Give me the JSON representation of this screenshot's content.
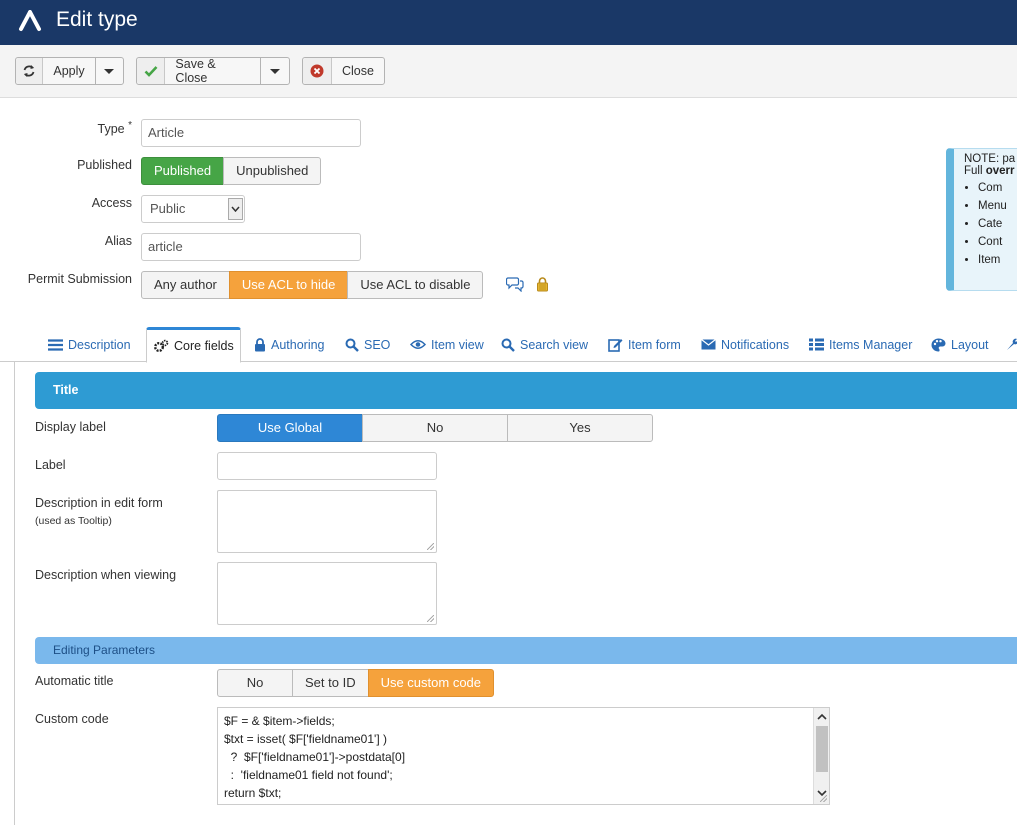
{
  "header": {
    "title": "Edit type"
  },
  "toolbar": {
    "apply": "Apply",
    "save_close": "Save & Close",
    "close": "Close"
  },
  "form": {
    "type_label": "Type",
    "required_mark": "*",
    "type_value": "Article",
    "published_label": "Published",
    "published_options": [
      "Published",
      "Unpublished"
    ],
    "published_selected": "Published",
    "access_label": "Access",
    "access_value": "Public",
    "alias_label": "Alias",
    "alias_value": "article",
    "permit_label": "Permit Submission",
    "permit_options": [
      "Any author",
      "Use ACL to hide",
      "Use ACL to disable"
    ],
    "permit_selected": "Use ACL to hide"
  },
  "note": {
    "line1": "NOTE: pa",
    "line2_prefix": "Full ",
    "line2_bold": "overr",
    "items": [
      "Com",
      "Menu",
      "Cate",
      "Cont",
      "Item"
    ]
  },
  "tabs": [
    {
      "label": "Description",
      "icon": "list-icon"
    },
    {
      "label": "Core fields",
      "icon": "cogs-icon",
      "active": true
    },
    {
      "label": "Authoring",
      "icon": "lock-icon"
    },
    {
      "label": "SEO",
      "icon": "search-icon"
    },
    {
      "label": "Item view",
      "icon": "eye-icon"
    },
    {
      "label": "Search view",
      "icon": "search-icon"
    },
    {
      "label": "Item form",
      "icon": "edit-icon"
    },
    {
      "label": "Notifications",
      "icon": "mail-icon"
    },
    {
      "label": "Items Manager",
      "icon": "grid-list-icon"
    },
    {
      "label": "Layout",
      "icon": "palette-icon"
    }
  ],
  "panel": {
    "section_title": "Title",
    "display_label": "Display label",
    "display_options": [
      "Use Global",
      "No",
      "Yes"
    ],
    "display_selected": "Use Global",
    "label_label": "Label",
    "label_value": "",
    "desc_edit_label": "Description in edit form",
    "desc_edit_hint": "(used as Tooltip)",
    "desc_view_label": "Description when viewing",
    "subsection_title": "Editing Parameters",
    "auto_title_label": "Automatic title",
    "auto_title_options": [
      "No",
      "Set to ID",
      "Use custom code"
    ],
    "auto_title_selected": "Use custom code",
    "custom_code_label": "Custom code",
    "custom_code": "$F = & $item->fields;\n$txt = isset( $F['fieldname01'] )\n  ?  $F['fieldname01']->postdata[0]\n  :  'fieldname01 field not found';\nreturn $txt;"
  },
  "colors": {
    "header_bg": "#1a3867",
    "published_green": "#46a546",
    "selected_orange": "#f5a23c",
    "selected_blue": "#2e87d6",
    "section_blue": "#2e9bd3",
    "subsection_blue": "#7ab8ec"
  }
}
